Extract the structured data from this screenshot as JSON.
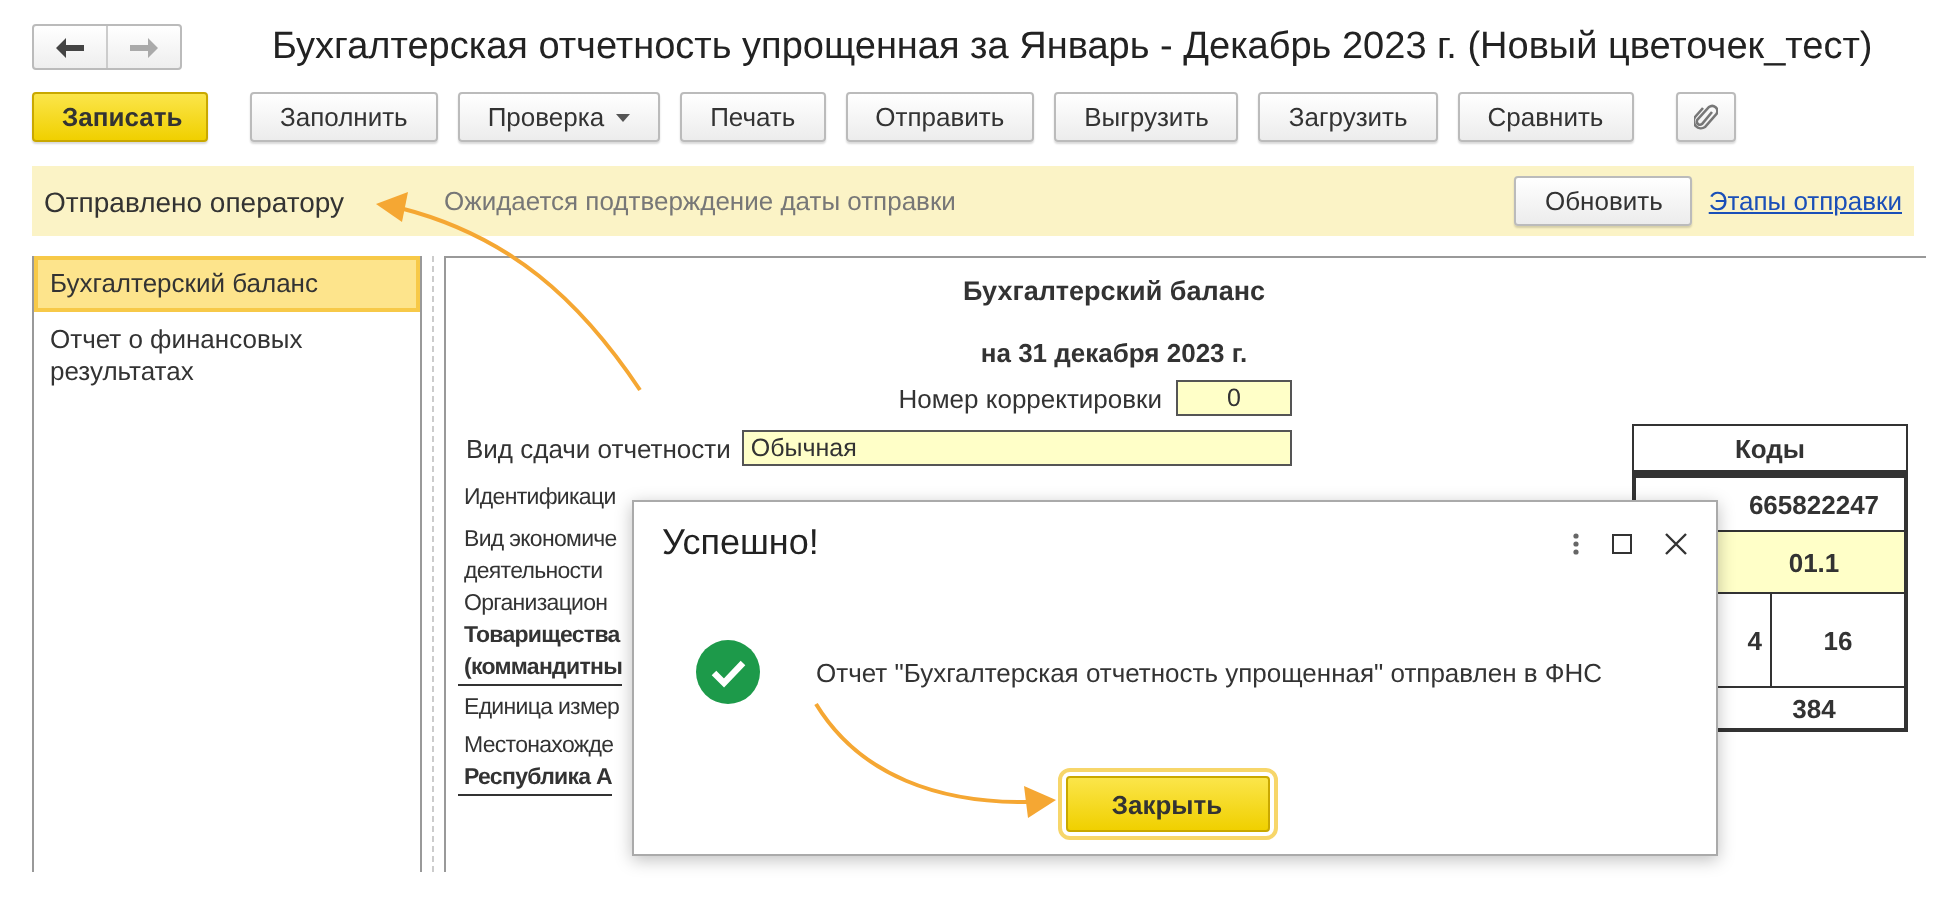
{
  "window": {
    "title": "Бухгалтерская отчетность упрощенная за Январь - Декабрь 2023 г. (Новый цветочек_тест)"
  },
  "toolbar": {
    "buttons": [
      {
        "kind": "primary",
        "label": "Записать"
      },
      {
        "kind": "plain",
        "label": "Заполнить"
      },
      {
        "kind": "dropdown",
        "label": "Проверка"
      },
      {
        "kind": "plain",
        "label": "Печать"
      },
      {
        "kind": "plain",
        "label": "Отправить"
      },
      {
        "kind": "plain",
        "label": "Выгрузить"
      },
      {
        "kind": "plain",
        "label": "Загрузить"
      },
      {
        "kind": "plain",
        "label": "Сравнить"
      },
      {
        "kind": "attach"
      }
    ]
  },
  "status_bar": {
    "state": "Отправлено оператору",
    "message": "Ожидается подтверждение даты отправки",
    "button": "Обновить",
    "link": "Этапы отправки"
  },
  "sidebar": {
    "items": [
      {
        "label": "Бухгалтерский баланс",
        "selected": true
      },
      {
        "label": "Отчет о финансовых результатах",
        "selected": false
      }
    ]
  },
  "report": {
    "title": "Бухгалтерский баланс",
    "date": "на 31 декабря 2023 г.",
    "correction": {
      "label": "Номер корректировки",
      "value": "0"
    },
    "submission": {
      "label": "Вид сдачи отчетности",
      "value": "Обычная"
    },
    "lines": [
      {
        "kind": "label",
        "text": "Идентификаци"
      },
      {
        "kind": "label",
        "text": "Вид экономиче"
      },
      {
        "kind": "label",
        "text": "деятельности"
      },
      {
        "kind": "label",
        "text": "Организацион"
      },
      {
        "kind": "value",
        "text": "Товарищества"
      },
      {
        "kind": "value",
        "text": "(коммандитны"
      },
      {
        "kind": "label",
        "text": "Единица измер"
      },
      {
        "kind": "label",
        "text": "Местонахожде"
      },
      {
        "kind": "value",
        "text": "Республика А"
      }
    ],
    "codes": {
      "title": "Коды",
      "rows": [
        {
          "kind": "text",
          "cells": [
            "665822247"
          ]
        },
        {
          "kind": "input",
          "cells": [
            "01.1"
          ]
        },
        {
          "kind": "text",
          "cells": [
            "4",
            "16"
          ]
        },
        {
          "kind": "text",
          "cells": [
            "384"
          ]
        }
      ]
    }
  },
  "dialog": {
    "title": "Успешно!",
    "message": "Отчет \"Бухгалтерская отчетность упрощенная\" отправлен в ФНС",
    "button": "Закрыть"
  }
}
